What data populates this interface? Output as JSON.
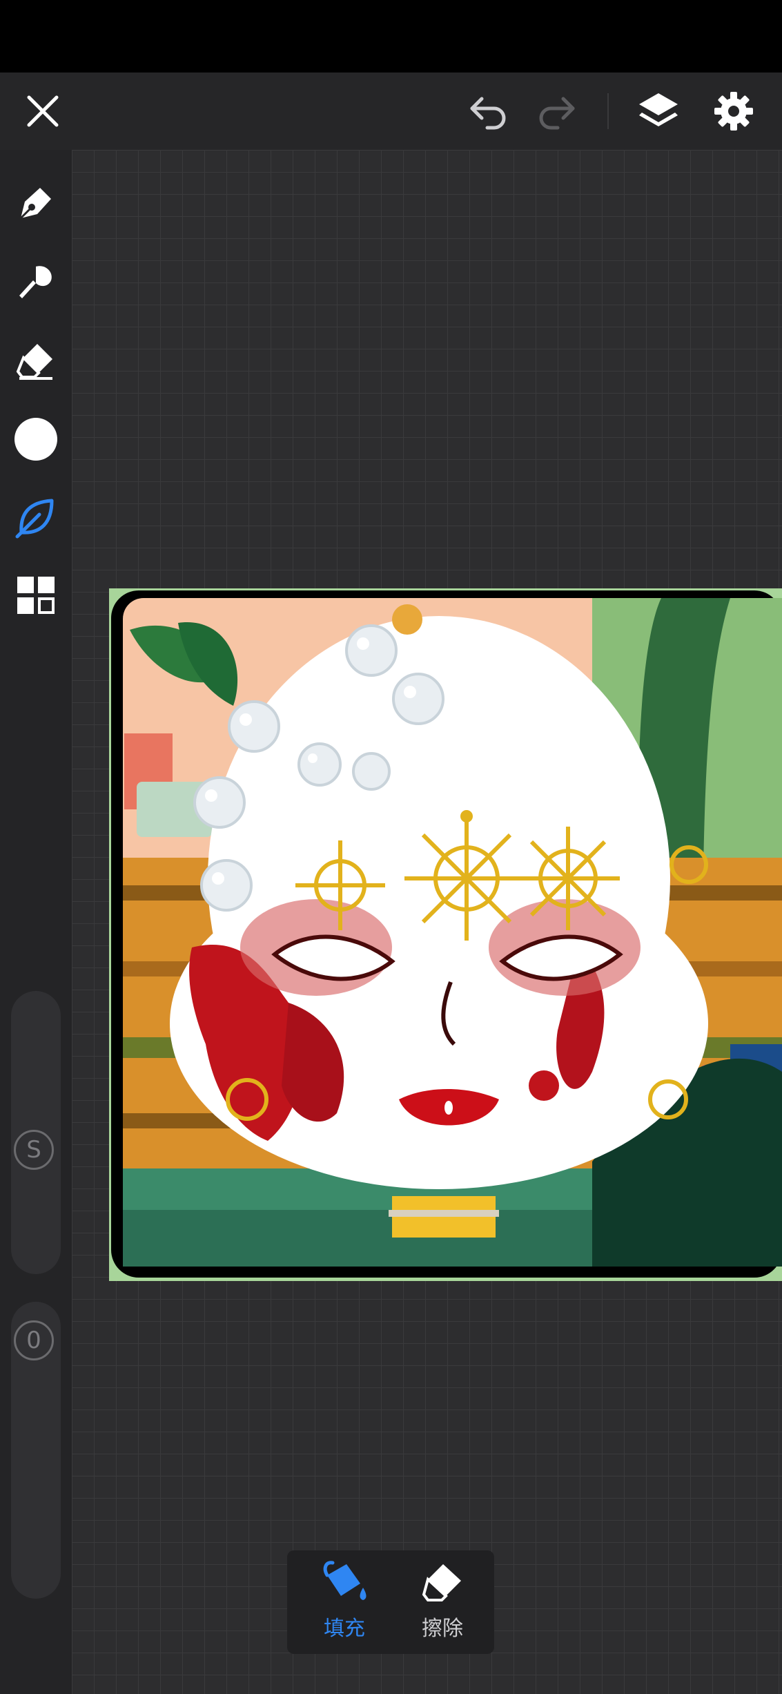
{
  "toolbar": {
    "close": "close",
    "undo": "undo",
    "redo": "redo",
    "layers": "layers",
    "settings": "settings"
  },
  "tools": [
    {
      "icon": "pen-icon"
    },
    {
      "icon": "brush-icon"
    },
    {
      "icon": "eraser-icon"
    },
    {
      "icon": "color-swatch",
      "color": "#ffffff"
    },
    {
      "icon": "leaf-icon",
      "active": true
    },
    {
      "icon": "grid-icon"
    }
  ],
  "sliders": {
    "size_label": "S",
    "opacity_label": "0"
  },
  "bottom_panel": {
    "fill_label": "填充",
    "erase_label": "擦除"
  },
  "colors": {
    "accent": "#2f86f2",
    "toolbar_bg": "#262628",
    "canvas_bg": "#2d2d2f"
  }
}
